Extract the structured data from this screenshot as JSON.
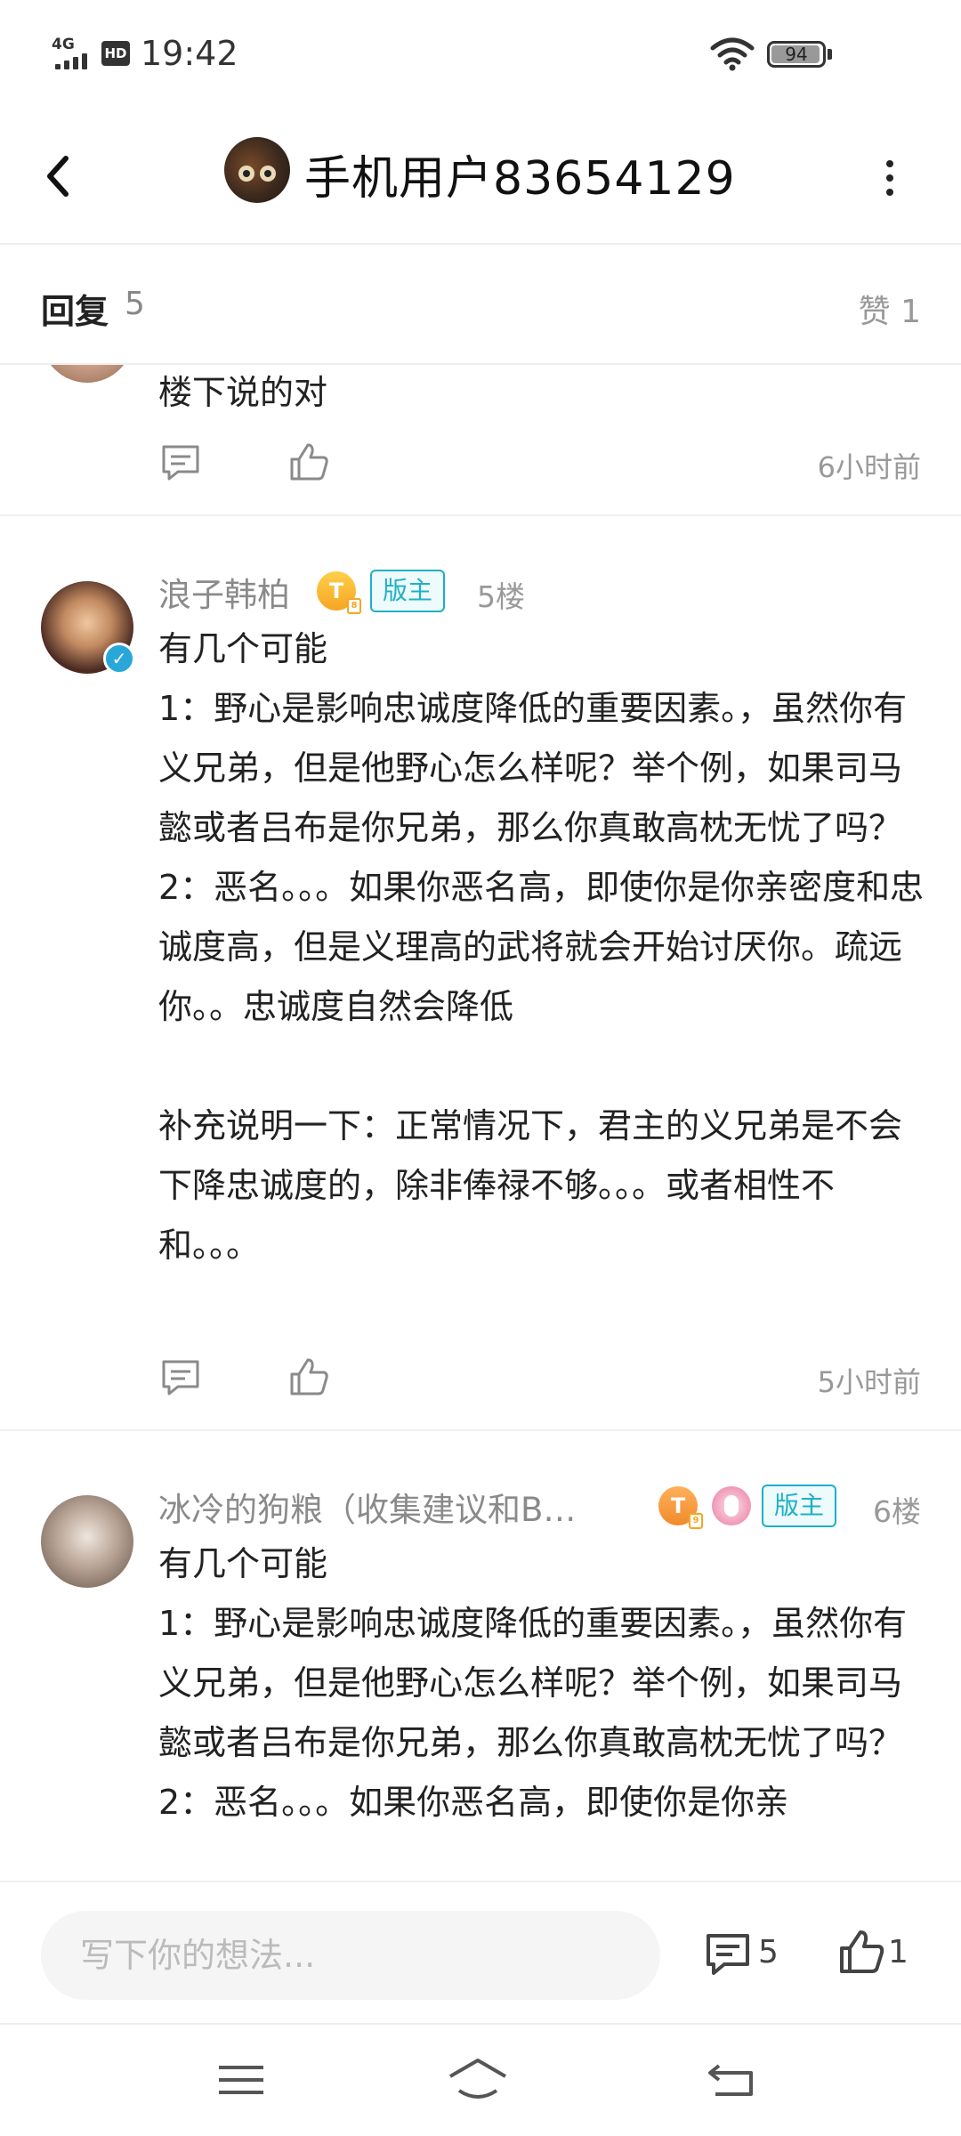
{
  "status_bar": {
    "network": "4G",
    "hd": "HD",
    "time": "19:42",
    "battery": "94"
  },
  "header": {
    "title": "手机用户83654129"
  },
  "reply_bar": {
    "label": "回复",
    "count": "5",
    "like_label": "赞 1"
  },
  "posts": [
    {
      "content": "楼下说的对",
      "time": "6小时前"
    },
    {
      "name": "浪子韩柏",
      "level": "T",
      "mod_tag": "版主",
      "floor": "5楼",
      "content": "有几个可能\n1：野心是影响忠诚度降低的重要因素。，虽然你有义兄弟，但是他野心怎么样呢？举个例，如果司马懿或者吕布是你兄弟，那么你真敢高枕无忧了吗？\n2：恶名。。。如果你恶名高，即使你是你亲密度和忠诚度高，但是义理高的武将就会开始讨厌你。疏远你。。忠诚度自然会降低\n\n补充说明一下：正常情况下，君主的义兄弟是不会下降忠诚度的，除非俸禄不够。。。或者相性不和。。。",
      "time": "5小时前"
    },
    {
      "name": "冰冷的狗粮（收集建议和B…",
      "level": "T",
      "mod_tag": "版主",
      "floor": "6楼",
      "content": "有几个可能\n1：野心是影响忠诚度降低的重要因素。，虽然你有义兄弟，但是他野心怎么样呢？举个例，如果司马懿或者吕布是你兄弟，那么你真敢高枕无忧了吗？\n2：恶名。。。如果你恶名高，即使你是你亲"
    }
  ],
  "bottom_bar": {
    "placeholder": "写下你的想法...",
    "comment_count": "5",
    "like_count": "1"
  }
}
